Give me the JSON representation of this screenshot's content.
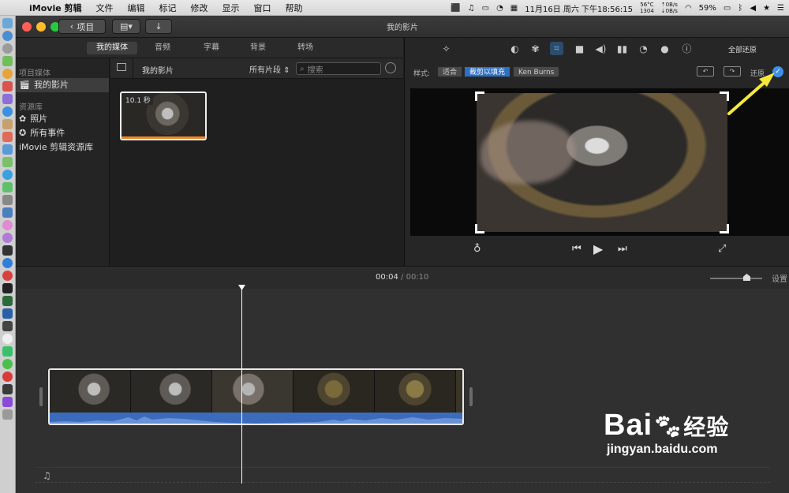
{
  "menubar": {
    "app": "iMovie 剪辑",
    "items": [
      "文件",
      "编辑",
      "标记",
      "修改",
      "显示",
      "窗口",
      "帮助"
    ],
    "cpu_temp": "56°C",
    "cpu_sub": "1304",
    "net_up": "0B/s",
    "net_down": "0B/s",
    "clock": "11月16日 周六 下午18:56:15",
    "battery": "59%"
  },
  "titlebar": {
    "back_label": "项目",
    "title": "我的影片"
  },
  "tabs": [
    "我的媒体",
    "音频",
    "字幕",
    "背景",
    "转场"
  ],
  "sidebar": {
    "section1": "项目媒体",
    "project_item": "我的影片",
    "section2": "资源库",
    "items": [
      "照片",
      "所有事件",
      "iMovie 剪辑资源库"
    ]
  },
  "browser": {
    "title": "我的影片",
    "filter": "所有片段",
    "search_placeholder": "搜索",
    "clip_duration": "10.1 秒"
  },
  "viewer": {
    "reset_all": "全部还原",
    "style_label": "样式:",
    "styles": [
      "适合",
      "裁剪以填充",
      "Ken Burns"
    ],
    "selected_style": "裁剪以填充",
    "reset": "还原"
  },
  "timeline": {
    "current_time": "00:04",
    "separator": "/",
    "total_time": "00:10",
    "settings": "设置"
  },
  "watermark": {
    "brand": "Bai",
    "brand2": "经验",
    "url": "jingyan.baidu.com"
  },
  "colors": {
    "accent": "#2f6fc4",
    "clip_bar": "#e8892b",
    "audio": "#3b6bbd",
    "arrow": "#f5e83a"
  }
}
